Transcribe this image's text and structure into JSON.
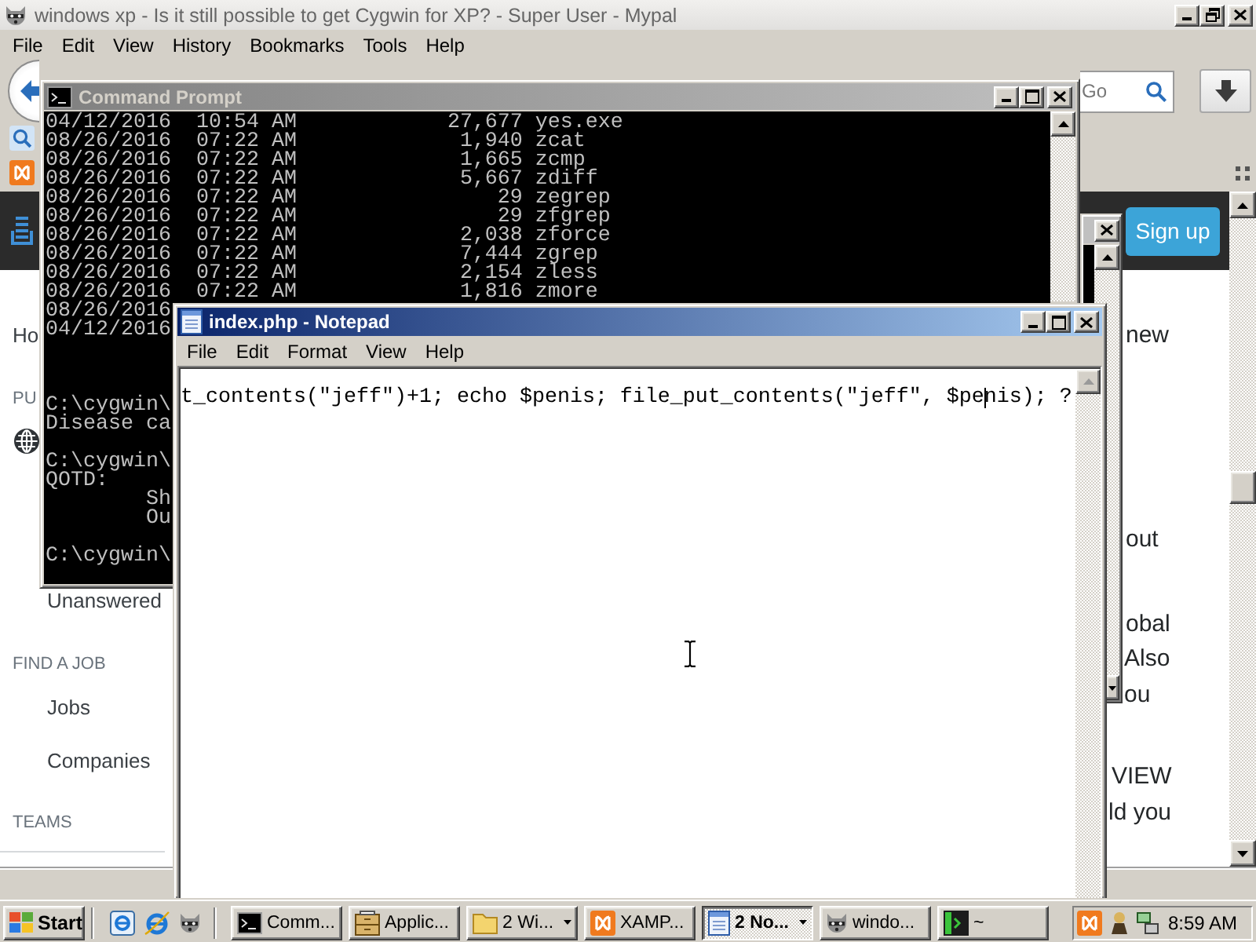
{
  "browser": {
    "title": "windows xp - Is it still possible to get Cygwin for XP? - Super User - Mypal",
    "active": false,
    "menu": [
      "File",
      "Edit",
      "View",
      "History",
      "Bookmarks",
      "Tools",
      "Help"
    ],
    "search": {
      "placeholder": "Go"
    },
    "page": {
      "header": {
        "button": "Sign up"
      },
      "nav": [
        {
          "kind": "top-link",
          "label": "Ho"
        },
        {
          "kind": "heading",
          "label": "PU"
        },
        {
          "kind": "icon-link"
        },
        {
          "kind": "link",
          "label": "Unanswered"
        },
        {
          "kind": "heading",
          "label": "FIND A JOB"
        },
        {
          "kind": "link",
          "label": "Jobs"
        },
        {
          "kind": "link",
          "label": "Companies"
        },
        {
          "kind": "heading",
          "label": "TEAMS"
        }
      ],
      "text_fragments": [
        "new",
        "out",
        "obal",
        "Also",
        "ou",
        "VIEW",
        "ld you"
      ]
    }
  },
  "terminal_window": {
    "active": false
  },
  "cmd": {
    "title": "Command Prompt",
    "active": false,
    "listing": [
      "04/12/2016  10:54 AM            27,677 yes.exe",
      "08/26/2016  07:22 AM             1,940 zcat",
      "08/26/2016  07:22 AM             1,665 zcmp",
      "08/26/2016  07:22 AM             5,667 zdiff",
      "08/26/2016  07:22 AM                29 zegrep",
      "08/26/2016  07:22 AM                29 zfgrep",
      "08/26/2016  07:22 AM             2,038 zforce",
      "08/26/2016  07:22 AM             7,444 zgrep",
      "08/26/2016  07:22 AM             2,154 zless",
      "08/26/2016  07:22 AM             1,816 zmore",
      "08/26/2016",
      "04/12/2016"
    ],
    "sessions": [
      {
        "prompt": "C:\\cygwin\\",
        "output": [
          "Disease ca"
        ]
      },
      {
        "prompt": "C:\\cygwin\\",
        "output": [
          "QOTD:",
          "        Sh",
          "        Ou"
        ]
      },
      {
        "prompt": "C:\\cygwin\\"
      }
    ]
  },
  "notepad": {
    "title": "index.php - Notepad",
    "active": true,
    "menu": [
      "File",
      "Edit",
      "Format",
      "View",
      "Help"
    ],
    "before_caret": "t_contents(\"jeff\")+1; echo $penis; file_put_contents(\"jeff\", $pe",
    "after_caret": "nis); ?"
  },
  "taskbar": {
    "start": "Start",
    "tasks": [
      {
        "label": "Comm...",
        "kind": "console",
        "grouped": false,
        "selected": false
      },
      {
        "label": "Applic...",
        "kind": "tools",
        "grouped": false,
        "selected": false
      },
      {
        "label": "2 Wi...",
        "kind": "folder",
        "grouped": true,
        "selected": false
      },
      {
        "label": "XAMP...",
        "kind": "knot",
        "grouped": false,
        "selected": false
      },
      {
        "label": "2 No...",
        "kind": "notepad",
        "grouped": true,
        "selected": true
      },
      {
        "label": "windo...",
        "kind": "browser",
        "grouped": false,
        "selected": false
      },
      {
        "label": "~",
        "kind": "terminal",
        "grouped": false,
        "selected": false
      }
    ],
    "clock": "8:59 AM"
  }
}
